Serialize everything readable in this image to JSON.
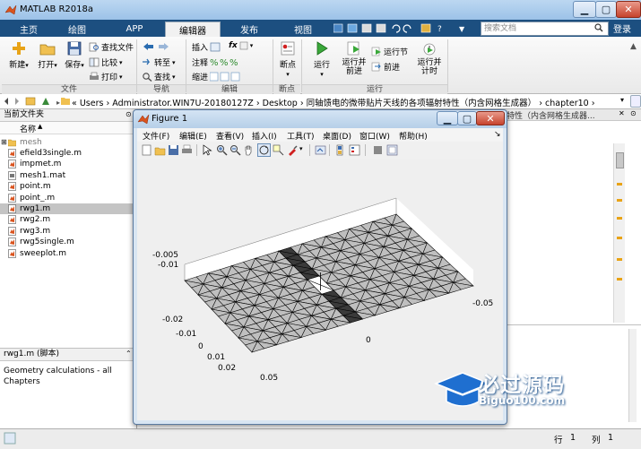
{
  "window": {
    "title": "MATLAB R2018a",
    "minimize": "▁",
    "maximize": "▢",
    "close": "✕"
  },
  "tabs": [
    {
      "label": "主页"
    },
    {
      "label": "绘图"
    },
    {
      "label": "APP"
    },
    {
      "label": "编辑器"
    },
    {
      "label": "发布"
    },
    {
      "label": "视图"
    }
  ],
  "search": {
    "placeholder": "搜索文档",
    "login": "登录"
  },
  "toolstrip": {
    "file": {
      "new": "新建",
      "open": "打开",
      "save": "保存",
      "find_files": "查找文件",
      "compare": "比较",
      "print": "打印",
      "group": "文件"
    },
    "navigate": {
      "goto": "转至",
      "find": "查找",
      "group": "导航"
    },
    "edit": {
      "insert": "插入",
      "fx": "fx",
      "comment": "注释",
      "indent": "缩进",
      "group": "编辑"
    },
    "breakpoints": {
      "label": "断点",
      "group": "断点"
    },
    "run": {
      "run": "运行",
      "run_advance": "运行并\n前进",
      "run_section": "运行节",
      "advance": "前进",
      "run_time": "运行并\n计时",
      "group": "运行"
    }
  },
  "address": {
    "path": [
      "Users",
      "Administrator.WIN7U-20180127Z",
      "Desktop",
      "同轴馈电的微带贴片天线的各项辐射特性（内含网格生成器）",
      "chapter10"
    ],
    "behind_text": "特性（内含网格生成器..."
  },
  "left_panel": {
    "title": "当前文件夹",
    "column": "名称",
    "folder": "mesh",
    "files": [
      "efield3single.m",
      "impmet.m",
      "mesh1.mat",
      "point.m",
      "point_.m",
      "rwg1.m",
      "rwg2.m",
      "rwg3.m",
      "rwg5single.m",
      "sweeplot.m"
    ],
    "selected": "rwg1.m",
    "details_title": "rwg1.m  (脚本)",
    "details_text": "Geometry calculations - all Chapters"
  },
  "statusbar": {
    "row_label": "行",
    "row": "1",
    "col_label": "列",
    "col": "1"
  },
  "figure": {
    "title": "Figure 1",
    "menus": [
      "文件(F)",
      "编辑(E)",
      "查看(V)",
      "插入(I)",
      "工具(T)",
      "桌面(D)",
      "窗口(W)",
      "帮助(H)"
    ],
    "axis_labels": {
      "z_left": [
        "-0.005",
        "-0.01"
      ],
      "y_left": [
        "-0.02",
        "-0.01",
        "0",
        "0.01",
        "0.02"
      ],
      "x_bottom": [
        "0",
        "0.05"
      ],
      "x_right": "-0.05"
    }
  },
  "watermark": {
    "title": "必过源码",
    "site": "Biguo100.com"
  },
  "colors": {
    "accent": "#1c4f80",
    "mesh_face": "#bfbfbf",
    "feed_strip": "#3a3a3a"
  }
}
